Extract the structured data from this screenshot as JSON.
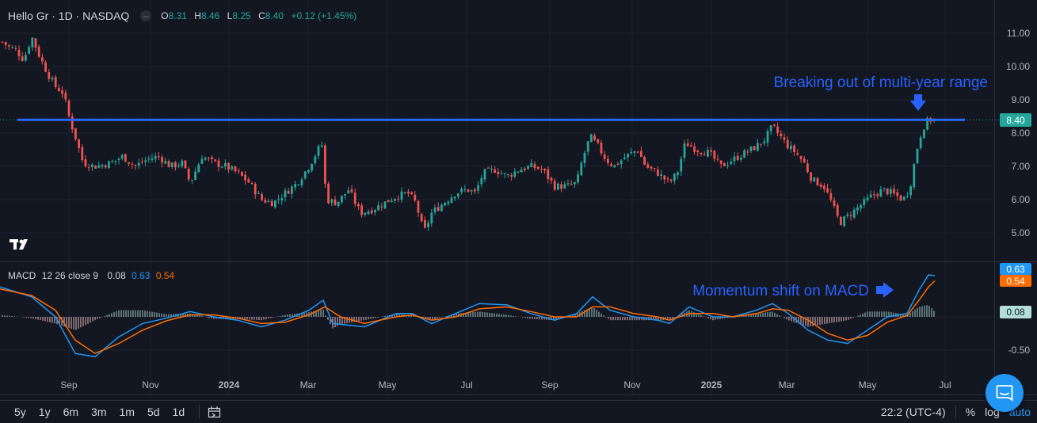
{
  "header": {
    "symbol_title": "Hello Gr · 1D · NASDAQ",
    "open_label": "O",
    "open": "8.31",
    "high_label": "H",
    "high": "8.46",
    "low_label": "L",
    "low": "8.25",
    "close_label": "C",
    "close": "8.40",
    "change": "+0.12 (+1.45%)"
  },
  "macd_legend": {
    "name": "MACD",
    "params": "12 26 close 9",
    "hist": "0.08",
    "macd": "0.63",
    "signal": "0.54"
  },
  "annotations": {
    "breakout_text": "Breaking out of multi-year range",
    "momentum_text": "Momentum shift on MACD"
  },
  "price_axis": {
    "ticks": [
      "11.00",
      "10.00",
      "9.00",
      "8.00",
      "7.00",
      "6.00",
      "5.00"
    ],
    "last_price_label": "8.40"
  },
  "macd_axis": {
    "ticks": [
      "0.00",
      "-0.50"
    ],
    "macd_badge": "0.63",
    "signal_badge": "0.54",
    "hist_badge": "0.08"
  },
  "time_axis": {
    "labels": [
      "Sep",
      "Nov",
      "2024",
      "Mar",
      "May",
      "Jul",
      "Sep",
      "Nov",
      "2025",
      "Mar",
      "May",
      "Jul"
    ]
  },
  "bottom_bar": {
    "ranges": [
      "5y",
      "1y",
      "6m",
      "3m",
      "1m",
      "5d",
      "1d"
    ],
    "time": "22:2 (UTC-4)",
    "percent": "%",
    "log": "log",
    "auto": "auto"
  },
  "colors": {
    "background": "#131722",
    "up": "#26a69a",
    "down": "#ef5350",
    "macd_line": "#2196f3",
    "signal_line": "#ff6d00",
    "resistance_line": "#2962ff",
    "annotation": "#2962ff",
    "hist_up": "#b2dfdb",
    "hist_down": "#ffcdd2"
  },
  "chart_data": [
    {
      "type": "candlestick",
      "title": "Hello Gr · 1D · NASDAQ",
      "ylim": [
        4.6,
        11.35
      ],
      "resistance_level": 8.4,
      "x_labels": [
        "Sep",
        "Nov",
        "2024",
        "Mar",
        "May",
        "Jul",
        "Sep",
        "Nov",
        "2025",
        "Mar",
        "May",
        "Jul"
      ],
      "price_path": [
        [
          0,
          10.8
        ],
        [
          10,
          10.6
        ],
        [
          20,
          10.5
        ],
        [
          30,
          10.2
        ],
        [
          40,
          10.9
        ],
        [
          50,
          10.3
        ],
        [
          60,
          9.8
        ],
        [
          70,
          9.4
        ],
        [
          80,
          9.2
        ],
        [
          88,
          8.4
        ],
        [
          95,
          7.9
        ],
        [
          105,
          7.1
        ],
        [
          120,
          7.0
        ],
        [
          140,
          7.1
        ],
        [
          155,
          7.3
        ],
        [
          170,
          7.0
        ],
        [
          185,
          7.2
        ],
        [
          200,
          7.3
        ],
        [
          215,
          7.0
        ],
        [
          230,
          7.1
        ],
        [
          240,
          6.5
        ],
        [
          255,
          7.3
        ],
        [
          270,
          7.1
        ],
        [
          285,
          7.0
        ],
        [
          300,
          6.8
        ],
        [
          315,
          6.5
        ],
        [
          330,
          6.0
        ],
        [
          345,
          5.9
        ],
        [
          360,
          6.2
        ],
        [
          375,
          6.5
        ],
        [
          390,
          7.0
        ],
        [
          406,
          7.7
        ],
        [
          412,
          6.0
        ],
        [
          425,
          5.9
        ],
        [
          440,
          6.3
        ],
        [
          455,
          5.6
        ],
        [
          470,
          5.7
        ],
        [
          485,
          5.9
        ],
        [
          500,
          6.1
        ],
        [
          515,
          6.2
        ],
        [
          525,
          5.9
        ],
        [
          535,
          5.0
        ],
        [
          545,
          5.6
        ],
        [
          560,
          5.9
        ],
        [
          575,
          6.2
        ],
        [
          590,
          6.3
        ],
        [
          600,
          6.2
        ],
        [
          610,
          6.8
        ],
        [
          625,
          6.9
        ],
        [
          640,
          6.7
        ],
        [
          655,
          6.9
        ],
        [
          670,
          7.0
        ],
        [
          685,
          6.9
        ],
        [
          700,
          6.4
        ],
        [
          715,
          6.4
        ],
        [
          728,
          6.5
        ],
        [
          735,
          7.2
        ],
        [
          745,
          7.9
        ],
        [
          755,
          7.6
        ],
        [
          765,
          7.2
        ],
        [
          775,
          7.0
        ],
        [
          790,
          7.3
        ],
        [
          805,
          7.5
        ],
        [
          815,
          7.0
        ],
        [
          830,
          6.8
        ],
        [
          845,
          6.5
        ],
        [
          855,
          6.8
        ],
        [
          865,
          7.7
        ],
        [
          880,
          7.5
        ],
        [
          895,
          7.4
        ],
        [
          910,
          7.0
        ],
        [
          925,
          7.2
        ],
        [
          940,
          7.4
        ],
        [
          955,
          7.6
        ],
        [
          965,
          7.8
        ],
        [
          975,
          8.2
        ],
        [
          985,
          7.9
        ],
        [
          995,
          7.6
        ],
        [
          1005,
          7.4
        ],
        [
          1015,
          7.1
        ],
        [
          1025,
          6.6
        ],
        [
          1040,
          6.4
        ],
        [
          1050,
          5.9
        ],
        [
          1060,
          5.3
        ],
        [
          1070,
          5.5
        ],
        [
          1085,
          5.8
        ],
        [
          1100,
          6.1
        ],
        [
          1115,
          6.3
        ],
        [
          1125,
          6.2
        ],
        [
          1140,
          6.0
        ],
        [
          1148,
          6.3
        ],
        [
          1155,
          7.2
        ],
        [
          1160,
          7.8
        ],
        [
          1166,
          8.2
        ],
        [
          1172,
          8.4
        ],
        [
          1180,
          8.4
        ]
      ],
      "last": {
        "open": 8.31,
        "high": 8.46,
        "low": 8.25,
        "close": 8.4
      }
    },
    {
      "type": "line",
      "title": "MACD 12 26 close 9",
      "ylim": [
        -0.6,
        0.75
      ],
      "series": [
        {
          "name": "MACD",
          "points": [
            [
              0,
              0.45
            ],
            [
              40,
              0.3
            ],
            [
              70,
              0.0
            ],
            [
              95,
              -0.55
            ],
            [
              120,
              -0.6
            ],
            [
              150,
              -0.3
            ],
            [
              180,
              -0.1
            ],
            [
              210,
              -0.02
            ],
            [
              240,
              0.08
            ],
            [
              270,
              0.0
            ],
            [
              300,
              -0.05
            ],
            [
              330,
              -0.15
            ],
            [
              360,
              -0.05
            ],
            [
              390,
              0.1
            ],
            [
              408,
              0.25
            ],
            [
              420,
              -0.1
            ],
            [
              460,
              -0.15
            ],
            [
              500,
              0.05
            ],
            [
              520,
              0.05
            ],
            [
              545,
              -0.1
            ],
            [
              575,
              0.05
            ],
            [
              605,
              0.2
            ],
            [
              640,
              0.18
            ],
            [
              670,
              0.05
            ],
            [
              700,
              -0.05
            ],
            [
              728,
              0.05
            ],
            [
              748,
              0.3
            ],
            [
              770,
              0.1
            ],
            [
              800,
              0.0
            ],
            [
              830,
              -0.05
            ],
            [
              845,
              -0.1
            ],
            [
              870,
              0.15
            ],
            [
              900,
              0.0
            ],
            [
              925,
              0.0
            ],
            [
              955,
              0.1
            ],
            [
              975,
              0.2
            ],
            [
              995,
              0.05
            ],
            [
              1020,
              -0.2
            ],
            [
              1045,
              -0.35
            ],
            [
              1070,
              -0.4
            ],
            [
              1095,
              -0.2
            ],
            [
              1120,
              0.0
            ],
            [
              1145,
              0.05
            ],
            [
              1160,
              0.4
            ],
            [
              1172,
              0.63
            ],
            [
              1180,
              0.62
            ]
          ]
        },
        {
          "name": "Signal",
          "points": [
            [
              0,
              0.42
            ],
            [
              40,
              0.32
            ],
            [
              70,
              0.1
            ],
            [
              95,
              -0.35
            ],
            [
              120,
              -0.55
            ],
            [
              150,
              -0.4
            ],
            [
              180,
              -0.2
            ],
            [
              210,
              -0.06
            ],
            [
              240,
              0.03
            ],
            [
              270,
              0.03
            ],
            [
              300,
              -0.02
            ],
            [
              330,
              -0.1
            ],
            [
              360,
              -0.08
            ],
            [
              390,
              0.03
            ],
            [
              410,
              0.15
            ],
            [
              430,
              0.0
            ],
            [
              460,
              -0.1
            ],
            [
              500,
              0.0
            ],
            [
              520,
              0.03
            ],
            [
              545,
              -0.05
            ],
            [
              575,
              0.0
            ],
            [
              605,
              0.12
            ],
            [
              640,
              0.15
            ],
            [
              670,
              0.08
            ],
            [
              700,
              0.0
            ],
            [
              728,
              0.0
            ],
            [
              748,
              0.15
            ],
            [
              770,
              0.15
            ],
            [
              800,
              0.05
            ],
            [
              830,
              0.0
            ],
            [
              845,
              -0.05
            ],
            [
              870,
              0.05
            ],
            [
              900,
              0.05
            ],
            [
              925,
              0.0
            ],
            [
              955,
              0.05
            ],
            [
              975,
              0.12
            ],
            [
              995,
              0.1
            ],
            [
              1020,
              -0.05
            ],
            [
              1045,
              -0.25
            ],
            [
              1070,
              -0.35
            ],
            [
              1095,
              -0.28
            ],
            [
              1120,
              -0.08
            ],
            [
              1145,
              0.02
            ],
            [
              1160,
              0.25
            ],
            [
              1172,
              0.45
            ],
            [
              1180,
              0.54
            ]
          ]
        }
      ],
      "histogram_last": 0.08
    }
  ]
}
